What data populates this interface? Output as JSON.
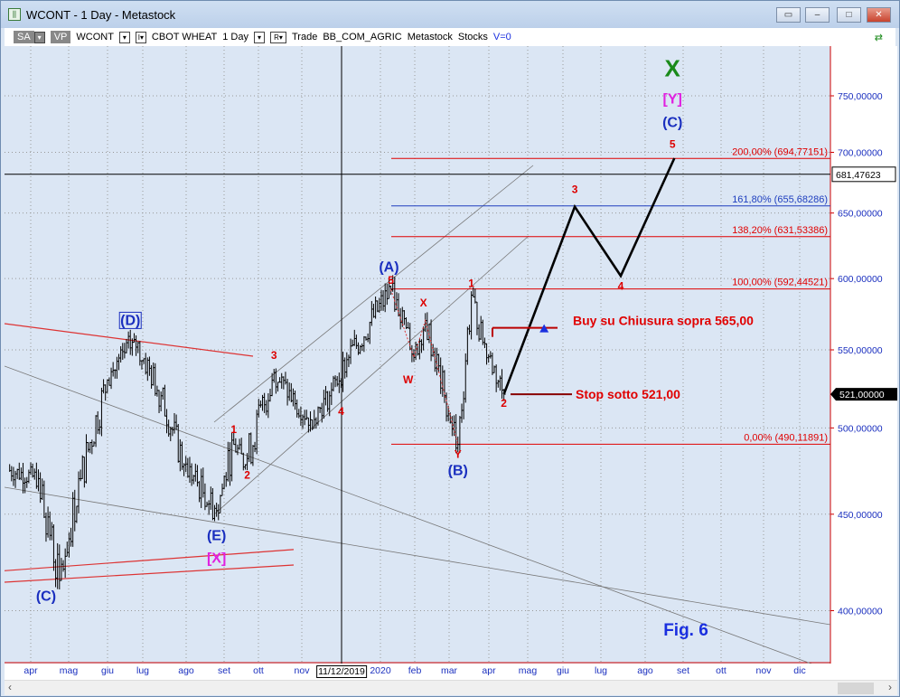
{
  "window": {
    "title": "WCONT - 1 Day - Metastock"
  },
  "toolbar": {
    "sa": "SA",
    "vp": "VP",
    "symbol": "WCONT",
    "name": "CBOT WHEAT",
    "period": "1 Day",
    "r": "R",
    "items": [
      "Trade",
      "BB_COM_AGRIC",
      "Metastock",
      "Stocks"
    ],
    "v": "V=0"
  },
  "chart_data": {
    "type": "ohlc-bar",
    "title": "CBOT WHEAT",
    "scale": "log",
    "ylim": [
      380,
      790
    ],
    "yticks": [
      {
        "v": 400,
        "l": "400,00000"
      },
      {
        "v": 450,
        "l": "450,00000"
      },
      {
        "v": 500,
        "l": "500,00000"
      },
      {
        "v": 550,
        "l": "550,00000"
      },
      {
        "v": 600,
        "l": "600,00000"
      },
      {
        "v": 650,
        "l": "650,00000"
      },
      {
        "v": 700,
        "l": "700,00000"
      },
      {
        "v": 750,
        "l": "750,00000"
      }
    ],
    "xticks": [
      "apr",
      "mag",
      "giu",
      "lug",
      "ago",
      "set",
      "ott",
      "nov",
      "11/12/2019",
      "2020",
      "feb",
      "mar",
      "apr",
      "mag",
      "giu",
      "lug",
      "ago",
      "set",
      "ott",
      "nov",
      "dic"
    ],
    "pivots": [
      [
        -0.6,
        475
      ],
      [
        0.2,
        470
      ],
      [
        0.75,
        415
      ],
      [
        1.3,
        470
      ],
      [
        2.0,
        530
      ],
      [
        2.7,
        557
      ],
      [
        3.4,
        520
      ],
      [
        4.0,
        478
      ],
      [
        4.85,
        452
      ],
      [
        5.3,
        490
      ],
      [
        5.6,
        478
      ],
      [
        6.35,
        535
      ],
      [
        6.9,
        515
      ],
      [
        7.3,
        505
      ],
      [
        7.8,
        520
      ],
      [
        8.3,
        545
      ],
      [
        9.4,
        592
      ],
      [
        9.8,
        565
      ],
      [
        10.0,
        545
      ],
      [
        10.3,
        570
      ],
      [
        10.8,
        520
      ],
      [
        11.15,
        490
      ],
      [
        11.5,
        588
      ],
      [
        11.8,
        555
      ],
      [
        12.35,
        521
      ]
    ],
    "last_price": "521,00000",
    "crosshair_price": "681,47623",
    "crosshair_date": "11/12/2019",
    "fib_levels": [
      {
        "v": 490.11891,
        "l": "0,00% (490,11891)",
        "c": "#e00000"
      },
      {
        "v": 592.44521,
        "l": "100,00% (592,44521)",
        "c": "#e00000"
      },
      {
        "v": 631.53386,
        "l": "138,20% (631,53386)",
        "c": "#e00000"
      },
      {
        "v": 655.68286,
        "l": "161,80% (655,68286)",
        "c": "#1f3fbf"
      },
      {
        "v": 694.77151,
        "l": "200,00% (694,77151)",
        "c": "#e00000"
      }
    ],
    "projection": [
      [
        12.35,
        521
      ],
      [
        14.2,
        655
      ],
      [
        15.4,
        602
      ],
      [
        16.8,
        695
      ]
    ],
    "wave_labels": [
      {
        "t": "(C)",
        "m": 0.4,
        "p": 405,
        "c": "#1a2fbf",
        "box": false
      },
      {
        "t": "(D)",
        "m": 2.6,
        "p": 567,
        "c": "#1a2fbf",
        "box": true
      },
      {
        "t": "(E)",
        "m": 4.85,
        "p": 436,
        "c": "#1a2fbf",
        "box": false
      },
      {
        "t": "[X]",
        "m": 4.85,
        "p": 424,
        "c": "#e020e0",
        "box": false
      },
      {
        "t": "1",
        "m": 5.3,
        "p": 497,
        "c": "#d00",
        "box": false
      },
      {
        "t": "2",
        "m": 5.65,
        "p": 470,
        "c": "#d00",
        "box": false
      },
      {
        "t": "3",
        "m": 6.35,
        "p": 544,
        "c": "#d00",
        "box": false
      },
      {
        "t": "4",
        "m": 8.1,
        "p": 508,
        "c": "#d00",
        "box": false
      },
      {
        "t": "(A)",
        "m": 9.35,
        "p": 605,
        "c": "#1a2fbf",
        "box": false
      },
      {
        "t": "5",
        "m": 9.4,
        "p": 596,
        "c": "#d00",
        "box": false
      },
      {
        "t": "X",
        "m": 10.25,
        "p": 580,
        "c": "#d00",
        "box": false
      },
      {
        "t": "W",
        "m": 9.85,
        "p": 528,
        "c": "#d00",
        "box": false
      },
      {
        "t": "Y",
        "m": 11.15,
        "p": 482,
        "c": "#d00",
        "box": false
      },
      {
        "t": "(B)",
        "m": 11.15,
        "p": 472,
        "c": "#1a2fbf",
        "box": false
      },
      {
        "t": "1",
        "m": 11.5,
        "p": 594,
        "c": "#d00",
        "box": false
      },
      {
        "t": "2",
        "m": 12.35,
        "p": 513,
        "c": "#d00",
        "box": false
      },
      {
        "t": "3",
        "m": 14.2,
        "p": 666,
        "c": "#d00",
        "box": false
      },
      {
        "t": "4",
        "m": 15.4,
        "p": 592,
        "c": "#d00",
        "box": false
      },
      {
        "t": "5",
        "m": 16.75,
        "p": 704,
        "c": "#d00",
        "box": false
      },
      {
        "t": "(C)",
        "m": 16.75,
        "p": 722,
        "c": "#1a2fbf",
        "box": false
      },
      {
        "t": "[Y]",
        "m": 16.75,
        "p": 743,
        "c": "#e020e0",
        "box": false
      },
      {
        "t": "X",
        "m": 16.75,
        "p": 768,
        "c": "#1a8a1a",
        "box": false
      }
    ],
    "annotations": [
      {
        "t": "Buy su Chiusura sopra 565,00",
        "level": 565
      },
      {
        "t": "Stop sotto 521,00",
        "level": 521
      }
    ],
    "figure_label": "Fig. 6"
  }
}
